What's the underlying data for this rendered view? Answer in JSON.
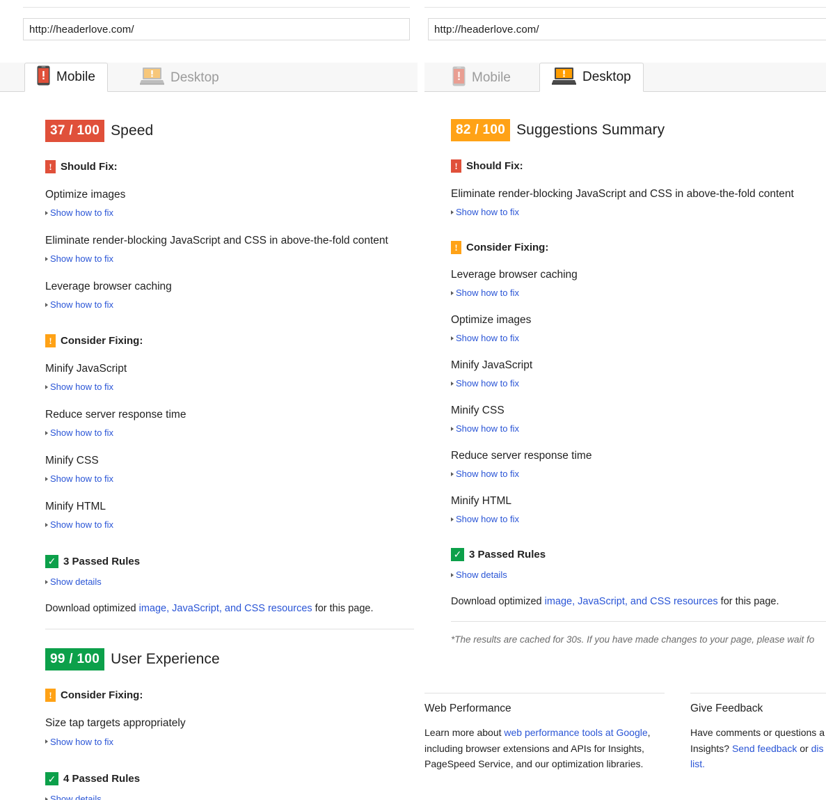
{
  "colors": {
    "red": "#e0503a",
    "orange": "#ffa216",
    "green": "#0ca04a",
    "link": "#2a55d6",
    "mobile_icon_active": "#e0503a",
    "mobile_icon_inactive": "#e99e92",
    "desktop_icon_active": "#ff9d00",
    "desktop_icon_inactive": "#f7c77a"
  },
  "left": {
    "url": {
      "value": "http://headerlove.com/"
    },
    "tabs": [
      {
        "label": "Mobile",
        "icon": "mobile-phone-icon",
        "active": true
      },
      {
        "label": "Desktop",
        "icon": "laptop-icon",
        "active": false
      }
    ],
    "sections": [
      {
        "score": "37 / 100",
        "score_color": "red",
        "title": "Speed",
        "groups": [
          {
            "badge": "!",
            "badge_color": "red",
            "label": "Should Fix:",
            "rules": [
              {
                "name": "Optimize images",
                "link": "Show how to fix"
              },
              {
                "name": "Eliminate render-blocking JavaScript and CSS in above-the-fold content",
                "link": "Show how to fix"
              },
              {
                "name": "Leverage browser caching",
                "link": "Show how to fix"
              }
            ]
          },
          {
            "badge": "!",
            "badge_color": "orange",
            "label": "Consider Fixing:",
            "rules": [
              {
                "name": "Minify JavaScript",
                "link": "Show how to fix"
              },
              {
                "name": "Reduce server response time",
                "link": "Show how to fix"
              },
              {
                "name": "Minify CSS",
                "link": "Show how to fix"
              },
              {
                "name": "Minify HTML",
                "link": "Show how to fix"
              }
            ]
          }
        ],
        "passed": {
          "label": "3 Passed Rules",
          "link": "Show details"
        },
        "download": {
          "prefix": "Download optimized ",
          "link": "image, JavaScript, and CSS resources",
          "suffix": " for this page."
        }
      },
      {
        "score": "99 / 100",
        "score_color": "green",
        "title": "User Experience",
        "groups": [
          {
            "badge": "!",
            "badge_color": "orange",
            "label": "Consider Fixing:",
            "rules": [
              {
                "name": "Size tap targets appropriately",
                "link": "Show how to fix"
              }
            ]
          }
        ],
        "passed": {
          "label": "4 Passed Rules",
          "link": "Show details"
        }
      }
    ]
  },
  "right": {
    "url": {
      "value": "http://headerlove.com/"
    },
    "tabs": [
      {
        "label": "Mobile",
        "icon": "mobile-phone-icon",
        "active": false
      },
      {
        "label": "Desktop",
        "icon": "laptop-icon",
        "active": true
      }
    ],
    "section": {
      "score": "82 / 100",
      "score_color": "orange",
      "title": "Suggestions Summary",
      "groups": [
        {
          "badge": "!",
          "badge_color": "red",
          "label": "Should Fix:",
          "rules": [
            {
              "name": "Eliminate render-blocking JavaScript and CSS in above-the-fold content",
              "link": "Show how to fix"
            }
          ]
        },
        {
          "badge": "!",
          "badge_color": "orange",
          "label": "Consider Fixing:",
          "rules": [
            {
              "name": "Leverage browser caching",
              "link": "Show how to fix"
            },
            {
              "name": "Optimize images",
              "link": "Show how to fix"
            },
            {
              "name": "Minify JavaScript",
              "link": "Show how to fix"
            },
            {
              "name": "Minify CSS",
              "link": "Show how to fix"
            },
            {
              "name": "Reduce server response time",
              "link": "Show how to fix"
            },
            {
              "name": "Minify HTML",
              "link": "Show how to fix"
            }
          ]
        }
      ],
      "passed": {
        "label": "3 Passed Rules",
        "link": "Show details"
      },
      "download": {
        "prefix": "Download optimized ",
        "link": "image, JavaScript, and CSS resources",
        "suffix": " for this page."
      },
      "cache_note": "*The results are cached for 30s. If you have made changes to your page, please wait fo"
    },
    "footer": {
      "columns": [
        {
          "title": "Web Performance",
          "body_pre": "Learn more about ",
          "body_link": "web performance tools at Google",
          "body_post": ", including browser extensions and APIs for Insights, PageSpeed Service, and our optimization libraries."
        },
        {
          "title": "Give Feedback",
          "body_pre": "Have comments or questions a",
          "body_mid": "Insights? ",
          "body_link": "Send feedback",
          "body_post": " or ",
          "body_link2": "dis",
          "body_tail": "list."
        }
      ]
    }
  }
}
